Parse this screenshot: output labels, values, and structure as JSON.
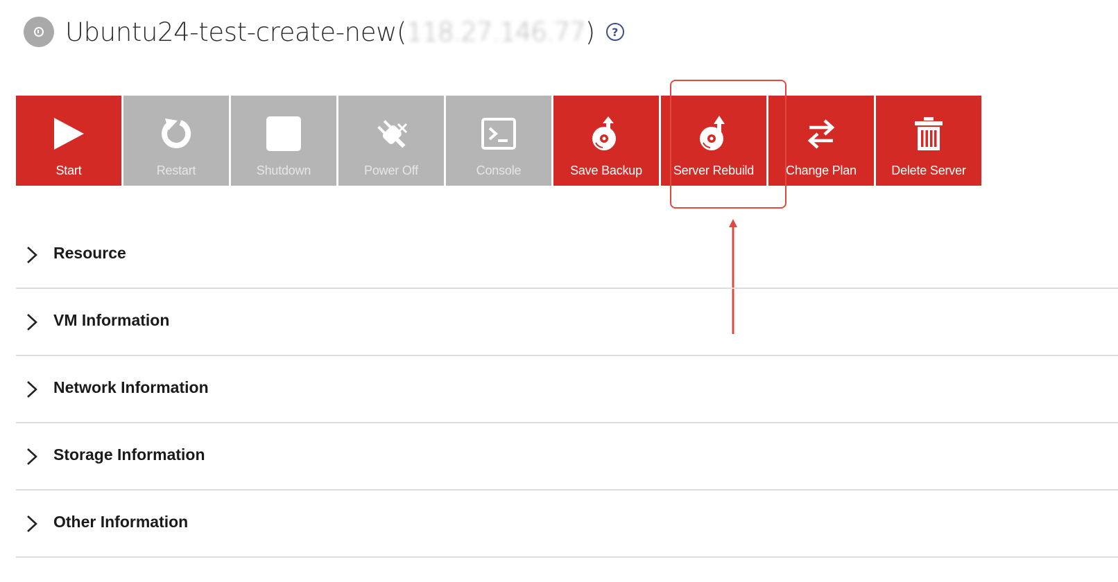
{
  "header": {
    "server_name": "Ubuntu24-test-create-new",
    "open_paren": " (",
    "ip_address": "118.27.146.77",
    "close_paren": ")",
    "status_color": "#a9a9a9",
    "status_icon": "power-status-icon",
    "help_icon": "help-circle-icon"
  },
  "toolbar": {
    "active_color": "#d42a26",
    "disabled_color": "#b5b5b5",
    "buttons": [
      {
        "label": "Start",
        "icon": "play-icon",
        "enabled": true
      },
      {
        "label": "Restart",
        "icon": "restart-icon",
        "enabled": false
      },
      {
        "label": "Shutdown",
        "icon": "stop-square-icon",
        "enabled": false
      },
      {
        "label": "Power Off",
        "icon": "power-plug-icon",
        "enabled": false
      },
      {
        "label": "Console",
        "icon": "terminal-icon",
        "enabled": false
      },
      {
        "label": "Save Backup",
        "icon": "disk-backup-icon",
        "enabled": true
      },
      {
        "label": "Server Rebuild",
        "icon": "disk-rebuild-icon",
        "enabled": true
      },
      {
        "label": "Change Plan",
        "icon": "swap-arrows-icon",
        "enabled": true
      },
      {
        "label": "Delete Server",
        "icon": "trash-icon",
        "enabled": true
      }
    ]
  },
  "annotation": {
    "highlight_target": "Server Rebuild",
    "color": "#e04a3c"
  },
  "sections": [
    {
      "label": "Resource"
    },
    {
      "label": "VM Information"
    },
    {
      "label": "Network Information"
    },
    {
      "label": "Storage Information"
    },
    {
      "label": "Other Information"
    }
  ]
}
